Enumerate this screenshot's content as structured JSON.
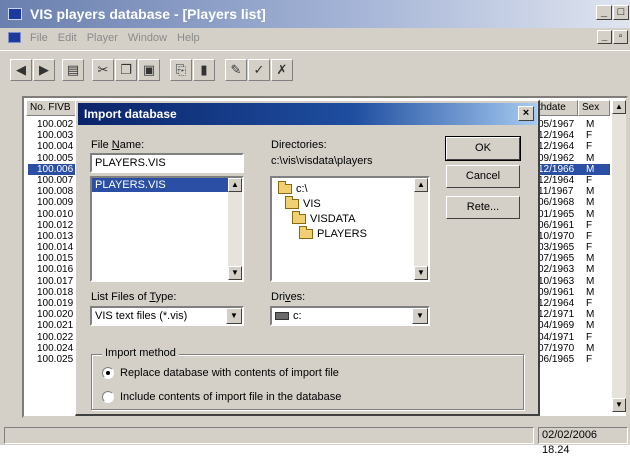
{
  "window": {
    "title": "VIS players database - [Players list]"
  },
  "menu": [
    "File",
    "Edit",
    "Player",
    "Window",
    "Help"
  ],
  "grid": {
    "col_fivb": "No. FIVB",
    "col_birthdate": "thdate",
    "col_sex": "Sex",
    "fivb_numbers": [
      "100.002",
      "100.003",
      "100.004",
      "100.005",
      "100.006",
      "100.007",
      "100.008",
      "100.009",
      "100.010",
      "100.012",
      "100.013",
      "100.014",
      "100.015",
      "100.016",
      "100.017",
      "100.018",
      "100.019",
      "100.020",
      "100.021",
      "100.022",
      "100.024",
      "100.025"
    ],
    "right_rows": [
      {
        "date": "05/1967",
        "sex": "M"
      },
      {
        "date": "12/1964",
        "sex": "F"
      },
      {
        "date": "12/1964",
        "sex": "F"
      },
      {
        "date": "09/1962",
        "sex": "M"
      },
      {
        "date": "12/1966",
        "sex": "M"
      },
      {
        "date": "12/1964",
        "sex": "F"
      },
      {
        "date": "11/1967",
        "sex": "M"
      },
      {
        "date": "06/1968",
        "sex": "M"
      },
      {
        "date": "01/1965",
        "sex": "M"
      },
      {
        "date": "06/1961",
        "sex": "F"
      },
      {
        "date": "10/1970",
        "sex": "F"
      },
      {
        "date": "03/1965",
        "sex": "F"
      },
      {
        "date": "07/1965",
        "sex": "M"
      },
      {
        "date": "02/1963",
        "sex": "M"
      },
      {
        "date": "10/1963",
        "sex": "M"
      },
      {
        "date": "09/1961",
        "sex": "M"
      },
      {
        "date": "12/1964",
        "sex": "F"
      },
      {
        "date": "12/1971",
        "sex": "M"
      },
      {
        "date": "04/1969",
        "sex": "M"
      },
      {
        "date": "04/1971",
        "sex": "F"
      },
      {
        "date": "07/1970",
        "sex": "M"
      },
      {
        "date": "06/1965",
        "sex": "F"
      }
    ]
  },
  "status": {
    "datetime": "02/02/2006 18.24"
  },
  "dialog": {
    "title": "Import database",
    "close": "×",
    "file_name_label_u": "N",
    "file_name_label_pre": "File ",
    "file_name_label_post": "ame:",
    "file_name_value": "PLAYERS.VIS",
    "file_list": [
      "PLAYERS.VIS"
    ],
    "directories_label": "Directories:",
    "current_dir": "c:\\vis\\visdata\\players",
    "dir_tree": [
      "c:\\",
      "VIS",
      "VISDATA",
      "PLAYERS"
    ],
    "list_type_label_pre": "List Files of ",
    "list_type_label_u": "T",
    "list_type_label_post": "ype:",
    "list_type_value": "VIS text files (*.vis)",
    "drives_label_pre": "Dri",
    "drives_label_u": "v",
    "drives_label_post": "es:",
    "drives_value": "c:",
    "ok_label": "OK",
    "cancel_label": "Cancel",
    "rete_label": "Rete...",
    "import_method_label": "Import method",
    "option_replace": "Replace database with contents of import file",
    "option_include": "Include contents of import file in the database",
    "selected_option": "replace"
  }
}
